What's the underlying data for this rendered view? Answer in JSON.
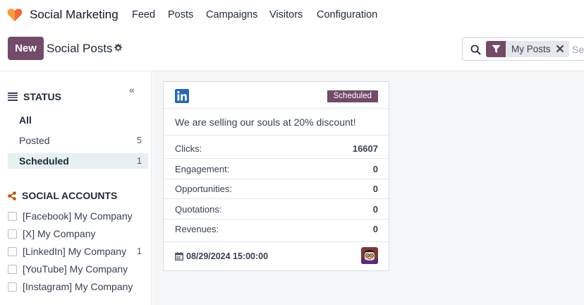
{
  "navbar": {
    "app_name": "Social Marketing",
    "menus": [
      "Feed",
      "Posts",
      "Campaigns",
      "Visitors",
      "Configuration"
    ]
  },
  "control_panel": {
    "new_label": "New",
    "title": "Social Posts",
    "search": {
      "facet_label": "My Posts",
      "placeholder": "Search..."
    }
  },
  "sidebar": {
    "status_title": "STATUS",
    "status_items": [
      {
        "label": "All",
        "count": ""
      },
      {
        "label": "Posted",
        "count": "5"
      },
      {
        "label": "Scheduled",
        "count": "1"
      }
    ],
    "accounts_title": "SOCIAL ACCOUNTS",
    "accounts": [
      {
        "label": "[Facebook] My Company",
        "count": ""
      },
      {
        "label": "[X] My Company",
        "count": ""
      },
      {
        "label": "[LinkedIn] My Company",
        "count": "1"
      },
      {
        "label": "[YouTube] My Company",
        "count": ""
      },
      {
        "label": "[Instagram] My Company",
        "count": ""
      }
    ]
  },
  "card": {
    "platform_icon": "linkedin-icon",
    "status": "Scheduled",
    "message": "We are selling our souls at 20% discount!",
    "stats": [
      {
        "label": "Clicks:",
        "value": "16607"
      },
      {
        "label": "Engagement:",
        "value": "0"
      },
      {
        "label": "Opportunities:",
        "value": "0"
      },
      {
        "label": "Quotations:",
        "value": "0"
      },
      {
        "label": "Revenues:",
        "value": "0"
      }
    ],
    "scheduled_date": "08/29/2024 15:00:00"
  },
  "colors": {
    "brand": "#714b67",
    "active_filter_bg": "#e6f0f1",
    "linkedin": "#2867b2",
    "background": "#f5f6f7"
  }
}
